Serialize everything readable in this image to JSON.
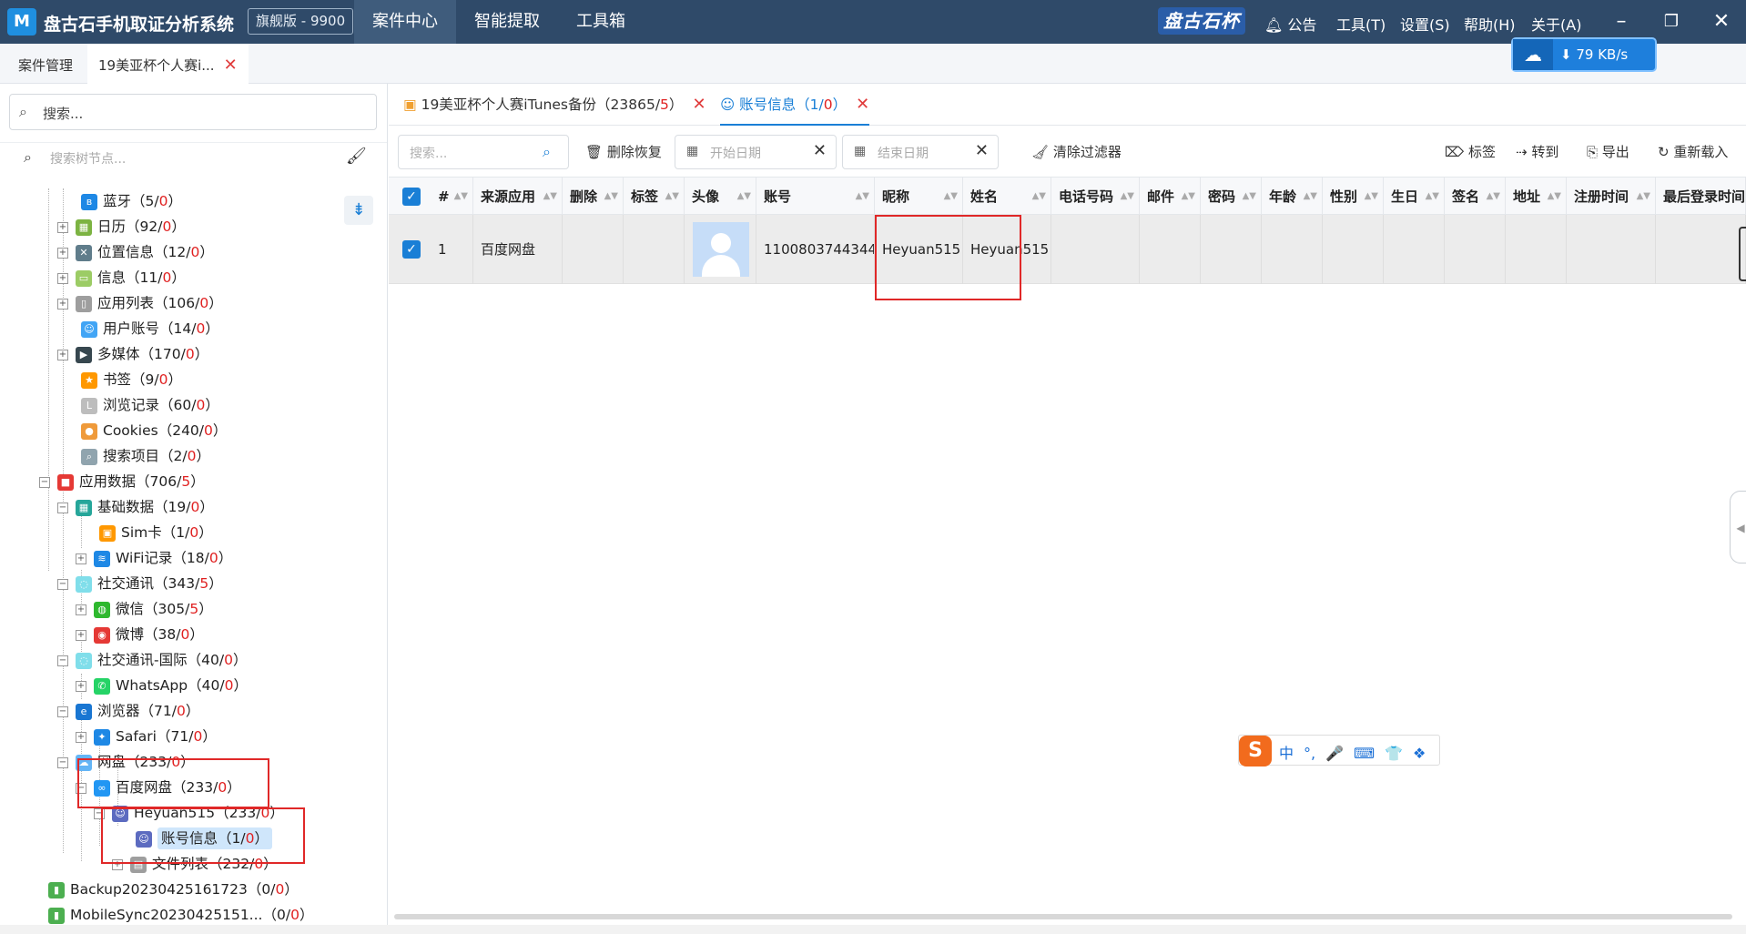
{
  "app": {
    "logo_letter": "M",
    "title": "盘古石手机取证分析系统",
    "edition": "旗舰版 - 9900",
    "nav": [
      "案件中心",
      "智能提取",
      "工具箱"
    ],
    "brand": "盘古石杯",
    "notice": "公告",
    "menus": [
      "工具(T)",
      "设置(S)",
      "帮助(H)",
      "关于(A)"
    ]
  },
  "case_tabs": {
    "manage": "案件管理",
    "current": "19美亚杯个人赛i..."
  },
  "speed": {
    "rate": "⬇ 79 KB/s"
  },
  "left": {
    "search_placeholder": "搜索...",
    "tree_search_placeholder": "搜索树节点...",
    "tree": [
      {
        "label": "蓝牙",
        "count": "5",
        "del": "0",
        "icon_color": "#1e88e5",
        "icon_glyph": "ʙ"
      },
      {
        "label": "日历",
        "count": "92",
        "del": "0",
        "icon_color": "#7cb342",
        "icon_glyph": "▦"
      },
      {
        "label": "位置信息",
        "count": "12",
        "del": "0",
        "icon_color": "#607d8b",
        "icon_glyph": "✕"
      },
      {
        "label": "信息",
        "count": "11",
        "del": "0",
        "icon_color": "#9ccc65",
        "icon_glyph": "▭"
      },
      {
        "label": "应用列表",
        "count": "106",
        "del": "0",
        "icon_color": "#9e9e9e",
        "icon_glyph": "▯"
      },
      {
        "label": "用户账号",
        "count": "14",
        "del": "0",
        "icon_color": "#42a5f5",
        "icon_glyph": "☺"
      },
      {
        "label": "多媒体",
        "count": "170",
        "del": "0",
        "icon_color": "#37474f",
        "icon_glyph": "▶"
      },
      {
        "label": "书签",
        "count": "9",
        "del": "0",
        "icon_color": "#ff9800",
        "icon_glyph": "★"
      },
      {
        "label": "浏览记录",
        "count": "60",
        "del": "0",
        "icon_color": "#bdbdbd",
        "icon_glyph": "L"
      },
      {
        "label": "Cookies",
        "count": "240",
        "del": "0",
        "icon_color": "#ef9a3a",
        "icon_glyph": "●"
      },
      {
        "label": "搜索项目",
        "count": "2",
        "del": "0",
        "icon_color": "#90a4ae",
        "icon_glyph": "⌕"
      },
      {
        "label": "应用数据",
        "count": "706",
        "del": "5",
        "icon_color": "#e53935",
        "icon_glyph": "■"
      },
      {
        "label": "基础数据",
        "count": "19",
        "del": "0",
        "icon_color": "#26a69a",
        "icon_glyph": "▦"
      },
      {
        "label": "Sim卡",
        "count": "1",
        "del": "0",
        "icon_color": "#ff9800",
        "icon_glyph": "▣"
      },
      {
        "label": "WiFi记录",
        "count": "18",
        "del": "0",
        "icon_color": "#1e88e5",
        "icon_glyph": "≋"
      },
      {
        "label": "社交通讯",
        "count": "343",
        "del": "5",
        "icon_color": "#80deea",
        "icon_glyph": "◌"
      },
      {
        "label": "微信",
        "count": "305",
        "del": "5",
        "icon_color": "#2eb82e",
        "icon_glyph": "◍"
      },
      {
        "label": "微博",
        "count": "38",
        "del": "0",
        "icon_color": "#e53935",
        "icon_glyph": "◉"
      },
      {
        "label": "社交通讯-国际",
        "count": "40",
        "del": "0",
        "icon_color": "#80deea",
        "icon_glyph": "◌"
      },
      {
        "label": "WhatsApp",
        "count": "40",
        "del": "0",
        "icon_color": "#25d366",
        "icon_glyph": "✆"
      },
      {
        "label": "浏览器",
        "count": "71",
        "del": "0",
        "icon_color": "#1976d2",
        "icon_glyph": "e"
      },
      {
        "label": "Safari",
        "count": "71",
        "del": "0",
        "icon_color": "#1e88e5",
        "icon_glyph": "✦"
      },
      {
        "label": "网盘",
        "count": "233",
        "del": "0",
        "icon_color": "#64b5f6",
        "icon_glyph": "☁"
      },
      {
        "label": "百度网盘",
        "count": "233",
        "del": "0",
        "icon_color": "#2196f3",
        "icon_glyph": "∞"
      },
      {
        "label": "Heyuan515",
        "count": "233",
        "del": "0",
        "icon_color": "#5c6bc0",
        "icon_glyph": "☺"
      },
      {
        "label": "账号信息",
        "count": "1",
        "del": "0",
        "icon_color": "#5c6bc0",
        "icon_glyph": "☺"
      },
      {
        "label": "文件列表",
        "count": "232",
        "del": "0",
        "icon_color": "#9e9e9e",
        "icon_glyph": "▤"
      },
      {
        "label": "Backup20230425161723",
        "count": "0",
        "del": "0",
        "icon_color": "#4caf50",
        "icon_glyph": "▮"
      },
      {
        "label": "MobileSync20230425151...",
        "count": "0",
        "del": "0",
        "icon_color": "#4caf50",
        "icon_glyph": "▮"
      }
    ]
  },
  "right": {
    "tabs": [
      {
        "label": "19美亚杯个人赛iTunes备份",
        "count": "23865",
        "del": "5"
      },
      {
        "label": "账号信息",
        "count": "1",
        "del": "0"
      }
    ],
    "toolbar": {
      "search_placeholder": "搜索...",
      "delete_restore": "删除恢复",
      "start_date": "开始日期",
      "end_date": "结束日期",
      "clear_filter": "清除过滤器",
      "tag": "标签",
      "goto": "转到",
      "export": "导出",
      "reload": "重新载入"
    },
    "columns": [
      "#",
      "来源应用",
      "删除",
      "标签",
      "头像",
      "账号",
      "昵称",
      "姓名",
      "电话号码",
      "邮件",
      "密码",
      "年龄",
      "性别",
      "生日",
      "签名",
      "地址",
      "注册时间",
      "最后登录时间"
    ],
    "rows": [
      {
        "index": "1",
        "source": "百度网盘",
        "deleted": "",
        "tag": "",
        "account": "1100803744344",
        "nickname": "Heyuan515",
        "name": "Heyuan515",
        "phone": "",
        "email": "",
        "password": "",
        "age": "",
        "gender": "",
        "birthday": "",
        "signature": "",
        "address": "",
        "registered": "",
        "last_login": ""
      }
    ]
  },
  "ime": {
    "s": "S",
    "items": [
      "中",
      "°,",
      "🎤",
      "⌨",
      "👕",
      "❖"
    ]
  }
}
